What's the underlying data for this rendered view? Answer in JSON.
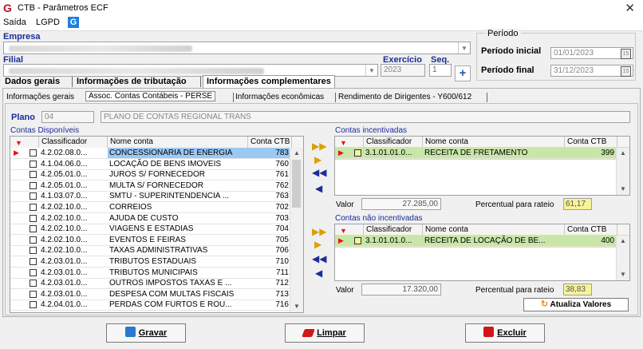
{
  "window": {
    "title": "CTB - Parâmetros ECF",
    "logo": "G",
    "close": "✕"
  },
  "menu": {
    "saida": "Saída",
    "lgpd": "LGPD",
    "lgpd_icon": "G"
  },
  "empresa": {
    "label": "Empresa"
  },
  "filial": {
    "label": "Filial"
  },
  "exercicio": {
    "label": "Exercício",
    "value": "2023"
  },
  "seq": {
    "label": "Seq.",
    "value": "1"
  },
  "periodo": {
    "legend": "Período",
    "inicial_label": "Período inicial",
    "inicial_value": "01/01/2023",
    "final_label": "Período final",
    "final_value": "31/12/2023",
    "cal": "15"
  },
  "plus": "+",
  "tabs": [
    "Dados gerais",
    "Informações de tributação",
    "Informações complementares"
  ],
  "subtabs": [
    "Informações gerais",
    "Assoc. Contas Contábeis - PERSE",
    "Informações econômicas",
    "Rendimento de Dirigentes - Y600/612"
  ],
  "plano": {
    "label": "Plano",
    "code": "04",
    "name": "PLANO DE CONTAS REGIONAL TRANS"
  },
  "disponiveis": {
    "title": "Contas Disponíveis",
    "cols": [
      "Classificador",
      "Nome conta",
      "Conta CTB"
    ],
    "rows": [
      {
        "c": "4.2.02.08.0...",
        "n": "CONCESSIONARIA DE ENERGIA",
        "v": "783"
      },
      {
        "c": "4.1.04.06.0...",
        "n": "LOCAÇÃO DE BENS IMOVEIS",
        "v": "760"
      },
      {
        "c": "4.2.05.01.0...",
        "n": "JUROS S/ FORNECEDOR",
        "v": "761"
      },
      {
        "c": "4.2.05.01.0...",
        "n": "MULTA S/ FORNECEDOR",
        "v": "762"
      },
      {
        "c": "4.1.03.07.0...",
        "n": "SMTU - SUPERINTENDENCIA ...",
        "v": "763"
      },
      {
        "c": "4.2.02.10.0...",
        "n": "CORREIOS",
        "v": "702"
      },
      {
        "c": "4.2.02.10.0...",
        "n": "AJUDA DE CUSTO",
        "v": "703"
      },
      {
        "c": "4.2.02.10.0...",
        "n": "VIAGENS E ESTADIAS",
        "v": "704"
      },
      {
        "c": "4.2.02.10.0...",
        "n": "EVENTOS E FEIRAS",
        "v": "705"
      },
      {
        "c": "4.2.02.10.0...",
        "n": "TAXAS ADMINISTRATIVAS",
        "v": "706"
      },
      {
        "c": "4.2.03.01.0...",
        "n": "TRIBUTOS ESTADUAIS",
        "v": "710"
      },
      {
        "c": "4.2.03.01.0...",
        "n": "TRIBUTOS MUNICIPAIS",
        "v": "711"
      },
      {
        "c": "4.2.03.01.0...",
        "n": "OUTROS IMPOSTOS TAXAS E ...",
        "v": "712"
      },
      {
        "c": "4.2.03.01.0...",
        "n": "DESPESA COM MULTAS FISCAIS",
        "v": "713"
      },
      {
        "c": "4.2.04.01.0...",
        "n": "PERDAS COM FURTOS E ROU...",
        "v": "716"
      }
    ]
  },
  "movers": {
    "add_all": "▶▶",
    "add": "▶",
    "remove_all": "◀◀",
    "remove": "◀"
  },
  "incentivadas": {
    "title": "Contas incentivadas",
    "cols": [
      "Classificador",
      "Nome conta",
      "Conta CTB"
    ],
    "rows": [
      {
        "c": "3.1.01.01.0...",
        "n": "RECEITA DE FRETAMENTO",
        "v": "399"
      }
    ],
    "valor_label": "Valor",
    "valor": "27.285,00",
    "pct_label": "Percentual para rateio",
    "pct": "61,17"
  },
  "nao_incentivadas": {
    "title": "Contas não incentivadas",
    "cols": [
      "Classificador",
      "Nome conta",
      "Conta CTB"
    ],
    "rows": [
      {
        "c": "3.1.01.01.0...",
        "n": "RECEITA DE LOCAÇÃO DE BE...",
        "v": "400"
      }
    ],
    "valor_label": "Valor",
    "valor": "17.320,00",
    "pct_label": "Percentual para rateio",
    "pct": "38,83"
  },
  "atualiza": "Atualiza Valores",
  "buttons": {
    "gravar": "Gravar",
    "limpar": "Limpar",
    "excluir": "Excluir"
  },
  "colors": {
    "accent": "#1a2b9a",
    "selection": "#3399ff",
    "highlight": "#c8e6a8",
    "marker": "#f6f39a"
  }
}
